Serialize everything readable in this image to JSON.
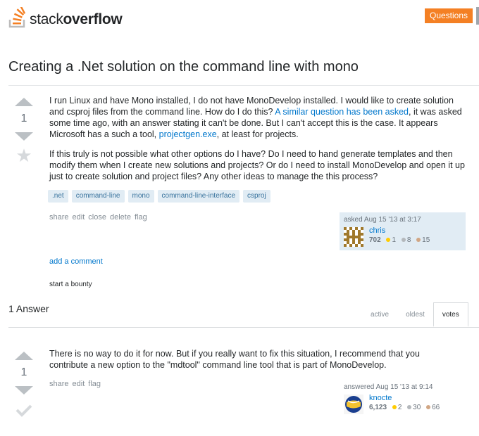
{
  "header": {
    "logo_text_light": "stack",
    "logo_text_bold": "overflow",
    "questions_button": "Questions",
    "brand_color": "#f48024"
  },
  "question": {
    "title": "Creating a .Net solution on the command line with mono",
    "votes": "1",
    "body": {
      "p1_part1": "I run Linux and have Mono installed, I do not have MonoDevelop installed. I would like to create solution and csproj files from the command line. How do I do this? ",
      "p1_link1": "A similar question has been asked",
      "p1_part2": ", it was asked some time ago, with an answer stating it can't be done. But I can't accept this is the case. It appears Microsoft has a such a tool, ",
      "p1_link2": "projectgen.exe",
      "p1_part3": ", at least for projects.",
      "p2": "If this truly is not possible what other options do I have? Do I need to hand generate templates and then modify them when I create new solutions and projects? Or do I need to install MonoDevelop and open it up just to create solution and project files? Any other ideas to manage the this process?"
    },
    "tags": [
      ".net",
      "command-line",
      "mono",
      "command-line-interface",
      "csproj"
    ],
    "menu": [
      "share",
      "edit",
      "close",
      "delete",
      "flag"
    ],
    "owner": {
      "action": "asked Aug 15 '13 at 3:17",
      "name": "chris",
      "reputation": "702",
      "gold": "1",
      "silver": "8",
      "bronze": "15"
    },
    "add_comment": "add a comment",
    "bounty": "start a bounty"
  },
  "answers_section": {
    "count_label": "1 Answer",
    "tabs": [
      "active",
      "oldest",
      "votes"
    ]
  },
  "answer": {
    "votes": "1",
    "body": "There is no way to do it for now. But if you really want to fix this situation, I recommend that you contribute a new option to the \"mdtool\" command line tool that is part of MonoDevelop.",
    "menu": [
      "share",
      "edit",
      "flag"
    ],
    "owner": {
      "action": "answered Aug 15 '13 at 9:14",
      "name": "knocte",
      "reputation": "6,123",
      "gold": "2",
      "silver": "30",
      "bronze": "66"
    }
  }
}
